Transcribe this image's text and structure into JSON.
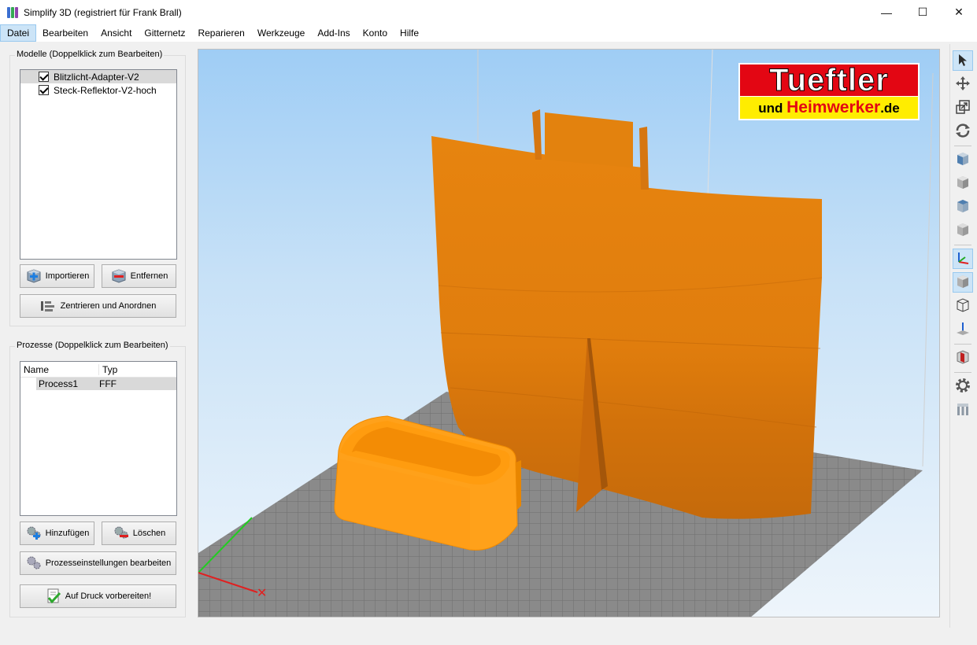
{
  "window": {
    "title": "Simplify 3D (registriert für Frank Brall)",
    "minimize": "—",
    "maximize": "☐",
    "close": "✕"
  },
  "menu": [
    "Datei",
    "Bearbeiten",
    "Ansicht",
    "Gitternetz",
    "Reparieren",
    "Werkzeuge",
    "Add-Ins",
    "Konto",
    "Hilfe"
  ],
  "models": {
    "title": "Modelle (Doppelklick zum Bearbeiten)",
    "items": [
      {
        "label": "Blitzlicht-Adapter-V2",
        "checked": true,
        "selected": true
      },
      {
        "label": "Steck-Reflektor-V2-hoch",
        "checked": true,
        "selected": false
      }
    ],
    "import_label": "Importieren",
    "remove_label": "Entfernen",
    "center_label": "Zentrieren und Anordnen"
  },
  "processes": {
    "title": "Prozesse (Doppelklick zum Bearbeiten)",
    "col_name": "Name",
    "col_type": "Typ",
    "rows": [
      {
        "name": "Process1",
        "type": "FFF"
      }
    ],
    "add_label": "Hinzufügen",
    "delete_label": "Löschen",
    "edit_label": "Prozesseinstellungen bearbeiten",
    "prepare_label": "Auf Druck vorbereiten!"
  },
  "logo": {
    "top": "Tueftler",
    "bottom_a": "und ",
    "bottom_b": "Heimwerker",
    "bottom_c": ".de"
  },
  "colors": {
    "model_primary": "#e07b0c",
    "model_secondary": "#ff9a0a",
    "platform": "#8a8a8a",
    "sky_top": "#9fcdf5"
  },
  "toolbar_icons": [
    "select-arrow-icon",
    "move-icon",
    "scale-icon",
    "rotate-icon",
    "view-front-icon",
    "view-top-icon",
    "view-left-icon",
    "view-right-icon",
    "axes-icon",
    "solid-view-icon",
    "wireframe-view-icon",
    "build-plate-icon",
    "cross-section-icon",
    "settings-gear-icon",
    "supports-icon"
  ]
}
